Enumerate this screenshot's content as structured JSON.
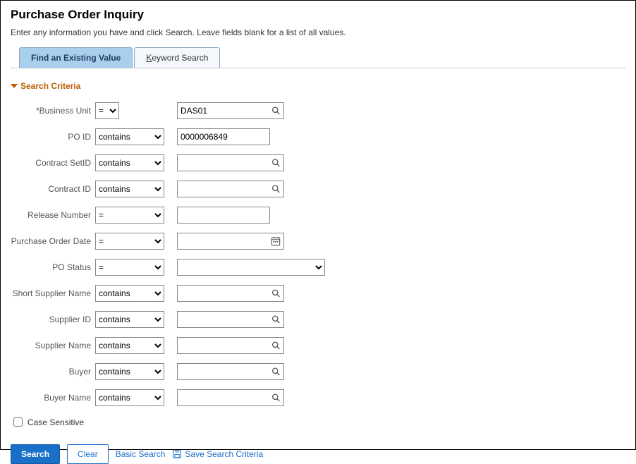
{
  "header": {
    "title": "Purchase Order Inquiry",
    "instructions": "Enter any information you have and click Search. Leave fields blank for a list of all values."
  },
  "tabs": {
    "existing": "Find an Existing Value",
    "keyword_prefix": "K",
    "keyword_rest": "eyword Search"
  },
  "section": {
    "title": "Search Criteria"
  },
  "fields": {
    "business_unit": {
      "label": "*Business Unit",
      "op": "=",
      "value": "DAS01"
    },
    "po_id": {
      "label": "PO ID",
      "op": "contains",
      "value": "0000006849"
    },
    "contract_setid": {
      "label": "Contract SetID",
      "op": "contains",
      "value": ""
    },
    "contract_id": {
      "label": "Contract ID",
      "op": "contains",
      "value": ""
    },
    "release_number": {
      "label": "Release Number",
      "op": "=",
      "value": ""
    },
    "po_date": {
      "label": "Purchase Order Date",
      "op": "=",
      "value": ""
    },
    "po_status": {
      "label": "PO Status",
      "op": "=",
      "value": ""
    },
    "short_supplier": {
      "label": "Short Supplier Name",
      "op": "contains",
      "value": ""
    },
    "supplier_id": {
      "label": "Supplier ID",
      "op": "contains",
      "value": ""
    },
    "supplier_name": {
      "label": "Supplier Name",
      "op": "contains",
      "value": ""
    },
    "buyer": {
      "label": "Buyer",
      "op": "contains",
      "value": ""
    },
    "buyer_name": {
      "label": "Buyer Name",
      "op": "contains",
      "value": ""
    }
  },
  "case_sensitive": {
    "label": "Case Sensitive",
    "checked": false
  },
  "buttons": {
    "search": "Search",
    "clear": "Clear",
    "basic_search": "Basic Search",
    "save_criteria": "Save Search Criteria"
  }
}
